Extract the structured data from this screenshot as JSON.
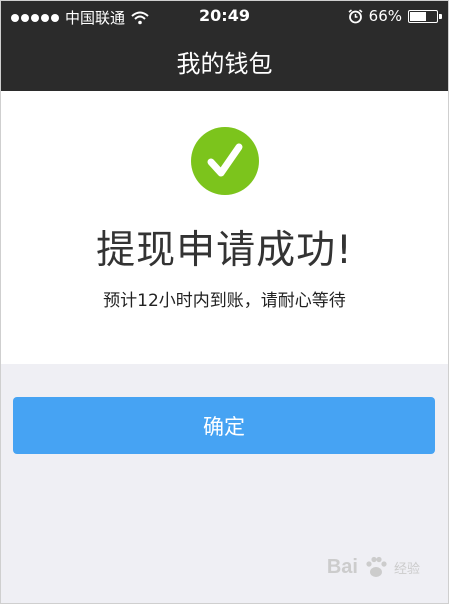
{
  "status_bar": {
    "carrier": "中国联通",
    "time": "20:49",
    "battery_text": "66%",
    "battery_level": 0.66
  },
  "nav": {
    "title": "我的钱包"
  },
  "result": {
    "title": "提现申请成功!",
    "subtitle": "预计12小时内到账，请耐心等待",
    "icon_color": "#7cc41c"
  },
  "actions": {
    "confirm_label": "确定",
    "confirm_color": "#46a3f3"
  },
  "watermark": {
    "brand": "Bai",
    "suffix": "经验"
  }
}
